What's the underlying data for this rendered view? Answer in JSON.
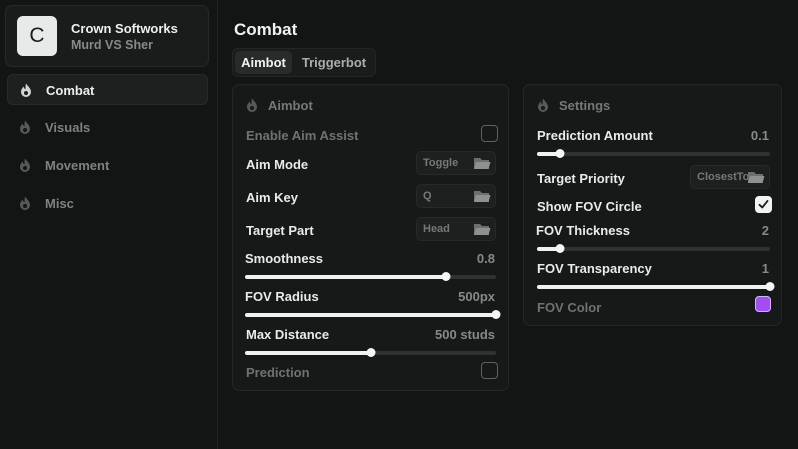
{
  "profile": {
    "initial": "C",
    "title": "Crown Softworks",
    "subtitle": "Murd VS Sher"
  },
  "nav": [
    {
      "label": "Combat",
      "icon": "flame-icon",
      "active": true
    },
    {
      "label": "Visuals",
      "icon": "flame-icon",
      "active": false
    },
    {
      "label": "Movement",
      "icon": "flame-icon",
      "active": false
    },
    {
      "label": "Misc",
      "icon": "flame-icon",
      "active": false
    }
  ],
  "page_title": "Combat",
  "tabs": [
    {
      "label": "Aimbot",
      "active": true
    },
    {
      "label": "Triggerbot",
      "active": false
    }
  ],
  "aimbot": {
    "title": "Aimbot",
    "enable_aim_assist": {
      "label": "Enable Aim Assist",
      "checked": false
    },
    "aim_mode": {
      "label": "Aim Mode",
      "value": "Toggle"
    },
    "aim_key": {
      "label": "Aim Key",
      "value": "Q"
    },
    "target_part": {
      "label": "Target Part",
      "value": "Head"
    },
    "smoothness": {
      "label": "Smoothness",
      "value": "0.8",
      "fraction": 0.8
    },
    "fov_radius": {
      "label": "FOV Radius",
      "value": "500px",
      "fraction": 1.0
    },
    "max_distance": {
      "label": "Max Distance",
      "value": "500 studs",
      "fraction": 0.5
    },
    "prediction": {
      "label": "Prediction",
      "checked": false
    }
  },
  "settings": {
    "title": "Settings",
    "prediction_amount": {
      "label": "Prediction Amount",
      "value": "0.1",
      "fraction": 0.1
    },
    "target_priority": {
      "label": "Target Priority",
      "value": "ClosestTo"
    },
    "show_fov_circle": {
      "label": "Show FOV Circle",
      "checked": true
    },
    "fov_thickness": {
      "label": "FOV Thickness",
      "value": "2",
      "fraction": 0.1
    },
    "fov_transparency": {
      "label": "FOV Transparency",
      "value": "1",
      "fraction": 1.0
    },
    "fov_color": {
      "label": "FOV Color",
      "color": "#a24cf2"
    }
  },
  "colors": {
    "accent": "#f0f2f1",
    "background": "#121514",
    "fov_color": "#a24cf2"
  }
}
